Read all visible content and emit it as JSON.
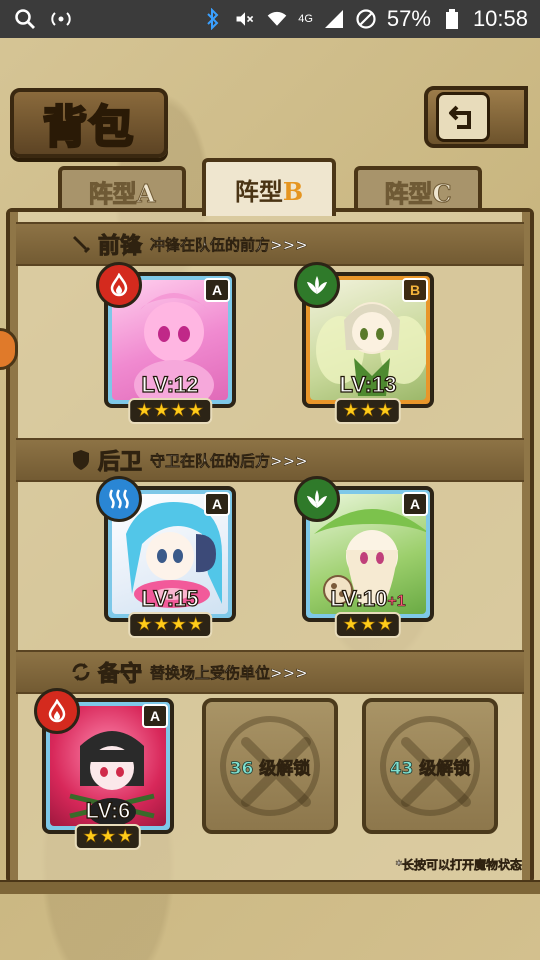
{
  "statusbar": {
    "battery": "57%",
    "time": "10:58",
    "network": "4G",
    "icons": [
      "search-icon",
      "signal-app-icon",
      "bluetooth-icon",
      "mute-icon",
      "wifi-icon",
      "cell-signal-icon",
      "no-disturb-icon",
      "battery-icon"
    ]
  },
  "header": {
    "title": "背包",
    "back_icon": "return-icon"
  },
  "tabs": [
    {
      "label": "阵型",
      "letter": "A",
      "active": false
    },
    {
      "label": "阵型",
      "letter": "B",
      "active": true
    },
    {
      "label": "阵型",
      "letter": "C",
      "active": false
    }
  ],
  "sections": {
    "front": {
      "name": "前锋",
      "desc": "冲锋在队伍的前方>>>",
      "icon": "sword-icon"
    },
    "rear": {
      "name": "后卫",
      "desc": "守卫在队伍的后方>>>",
      "icon": "shield-icon"
    },
    "reserve": {
      "name": "备守",
      "desc": "替换场上受伤单位>>>",
      "icon": "swap-icon"
    }
  },
  "units": {
    "front1": {
      "level": "LV:12",
      "rank": "A",
      "element": "fire",
      "stars": 4
    },
    "front2": {
      "level": "LV:13",
      "rank": "B",
      "element": "leaf",
      "stars": 3
    },
    "rear1": {
      "level": "LV:15",
      "rank": "A",
      "element": "water",
      "stars": 4
    },
    "rear2": {
      "level": "LV:10",
      "plus": "+1",
      "rank": "A",
      "element": "leaf",
      "stars": 3
    },
    "reserve1": {
      "level": "LV:6",
      "rank": "A",
      "element": "fire",
      "stars": 3
    }
  },
  "locked_slots": [
    {
      "level": "36",
      "label": "级解锁"
    },
    {
      "level": "43",
      "label": "级解锁"
    }
  ],
  "hint": "*长按可以打开魔物状态",
  "colors": {
    "rank_a": "#7ec8e8",
    "rank_b": "#e8962a",
    "fire": "#d42a1e",
    "leaf": "#2f7a2a",
    "water": "#2a86d4"
  }
}
